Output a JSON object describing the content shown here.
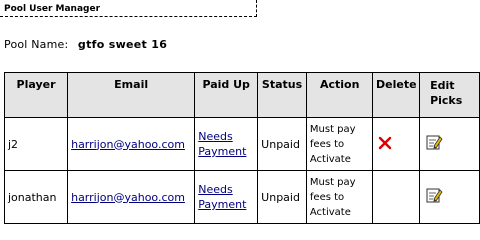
{
  "header": {
    "title": "Pool User Manager"
  },
  "pool": {
    "label": "Pool Name:",
    "name": "gtfo sweet 16"
  },
  "table": {
    "columns": [
      "Player",
      "Email",
      "Paid Up",
      "Status",
      "Action",
      "Delete",
      "Edit Picks"
    ],
    "rows": [
      {
        "player": "j2",
        "email": "harrijon@yahoo.com",
        "paid_link": "Needs Payment",
        "status": "Unpaid",
        "action": "Must pay fees to Activate",
        "delete": "delete-x-icon",
        "edit": "edit-pencil-icon"
      },
      {
        "player": "jonathan",
        "email": "harrijon@yahoo.com",
        "paid_link": "Needs Payment",
        "status": "Unpaid",
        "action": "Must pay fees to Activate",
        "edit": "edit-pencil-icon"
      }
    ]
  },
  "colors": {
    "header_bg": "#e4e4e4",
    "link": "#00007f",
    "delete_red": "#dd0000"
  }
}
